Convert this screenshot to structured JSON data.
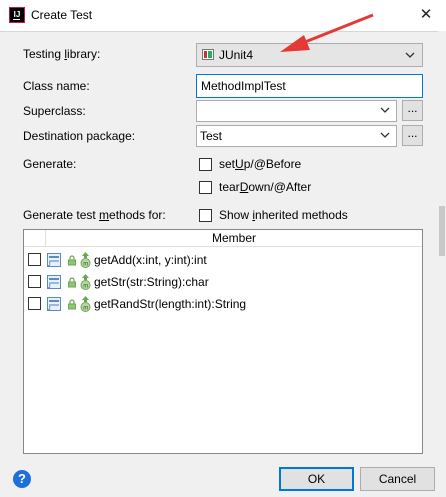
{
  "window": {
    "title": "Create Test",
    "close_glyph": "✕"
  },
  "form": {
    "testing_library": {
      "label": "Testing library:",
      "mnemonic": "l",
      "value": "JUnit4"
    },
    "class_name": {
      "label": "Class name:",
      "value": "MethodImplTest"
    },
    "superclass": {
      "label": "Superclass:",
      "value": "",
      "browse_label": "..."
    },
    "destination_package": {
      "label": "Destination package:",
      "value": "Test",
      "browse_label": "..."
    },
    "generate": {
      "label": "Generate:",
      "setup": {
        "pre": "set",
        "mn": "U",
        "post": "p/@Before",
        "checked": false
      },
      "teardown": {
        "pre": "tear",
        "mn": "D",
        "post": "own/@After",
        "checked": false
      }
    },
    "methods_for": {
      "label_pre": "Generate test ",
      "label_mn": "m",
      "label_post": "ethods for:",
      "show_inherited": {
        "pre": "Show ",
        "mn": "i",
        "post": "nherited methods",
        "checked": false
      }
    }
  },
  "members_table": {
    "header": "Member",
    "rows": [
      {
        "signature": "getAdd(x:int, y:int):int",
        "checked": false
      },
      {
        "signature": "getStr(str:String):char",
        "checked": false
      },
      {
        "signature": "getRandStr(length:int):String",
        "checked": false
      }
    ]
  },
  "buttons": {
    "ok": "OK",
    "cancel": "Cancel",
    "help": "?"
  },
  "colors": {
    "accent": "#0078d7",
    "annotation_arrow": "#e53935",
    "help": "#1e6fd9"
  }
}
